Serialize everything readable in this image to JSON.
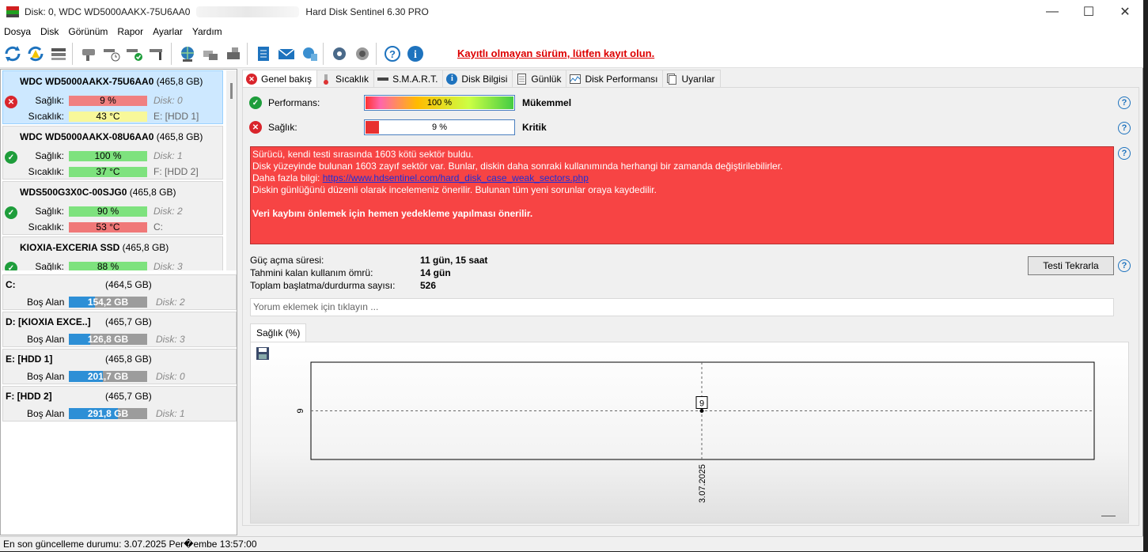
{
  "window": {
    "title_disk": "Disk: 0, WDC WD5000AAKX-75U6AA0",
    "title_app": "Hard Disk Sentinel 6.30 PRO",
    "min": "—",
    "max": "☐",
    "close": "✕"
  },
  "menu": [
    "Dosya",
    "Disk",
    "Görünüm",
    "Rapor",
    "Ayarlar",
    "Yardım"
  ],
  "toolbar": {
    "register_text": "Kayıtlı olmayan sürüm, lütfen kayıt olun."
  },
  "disks": [
    {
      "name": "WDC WD5000AAKX-75U6AA0",
      "size": "(465,8 GB)",
      "status": "bad",
      "health_label": "Sağlık:",
      "health": "9 %",
      "health_value": 9,
      "temp_label": "Sıcaklık:",
      "temp": "43 °C",
      "disk_ref": "Disk: 0",
      "drive": "E: [HDD 1]",
      "selected": true
    },
    {
      "name": "WDC WD5000AAKX-08U6AA0",
      "size": "(465,8 GB)",
      "status": "ok",
      "health_label": "Sağlık:",
      "health": "100 %",
      "health_value": 100,
      "temp_label": "Sıcaklık:",
      "temp": "37 °C",
      "disk_ref": "Disk: 1",
      "drive": "F: [HDD 2]"
    },
    {
      "name": "WDS500G3X0C-00SJG0",
      "size": "(465,8 GB)",
      "status": "ok",
      "health_label": "Sağlık:",
      "health": "90 %",
      "health_value": 90,
      "temp_label": "Sıcaklık:",
      "temp": "53 °C",
      "disk_ref": "Disk: 2",
      "drive": "C:"
    },
    {
      "name": "KIOXIA-EXCERIA SSD",
      "size": "(465,8 GB)",
      "status": "ok",
      "health_label": "Sağlık:",
      "health": "88 %",
      "health_value": 88,
      "disk_ref": "Disk: 3"
    }
  ],
  "volumes": [
    {
      "name": "C:",
      "size": "(464,5 GB)",
      "free_label": "Boş Alan",
      "free": "154,2 GB",
      "free_fraction": 0.33,
      "disk": "Disk: 2"
    },
    {
      "name": "D: [KIOXIA EXCE..]",
      "size": "(465,7 GB)",
      "free_label": "Boş Alan",
      "free": "126,8 GB",
      "free_fraction": 0.27,
      "disk": "Disk: 3"
    },
    {
      "name": "E: [HDD 1]",
      "size": "(465,8 GB)",
      "free_label": "Boş Alan",
      "free": "201,7 GB",
      "free_fraction": 0.43,
      "disk": "Disk: 0"
    },
    {
      "name": "F: [HDD 2]",
      "size": "(465,7 GB)",
      "free_label": "Boş Alan",
      "free": "291,8 GB",
      "free_fraction": 0.63,
      "disk": "Disk: 1"
    }
  ],
  "tabs": [
    "Genel bakış",
    "Sıcaklık",
    "S.M.A.R.T.",
    "Disk Bilgisi",
    "Günlük",
    "Disk Performansı",
    "Uyarılar"
  ],
  "overview": {
    "performance_label": "Performans:",
    "performance": "100 %",
    "performance_value": 100,
    "performance_word": "Mükemmel",
    "health_label": "Sağlık:",
    "health": "9 %",
    "health_value": 9,
    "health_word": "Kritik",
    "alert_lines": [
      "Sürücü, kendi testi sırasında 1603 kötü sektör buldu.",
      "Disk yüzeyinde bulunan 1603 zayıf sektör var. Bunlar, diskin daha sonraki kullanımında herhangi bir zamanda değiştirilebilirler."
    ],
    "alert_more_prefix": "Daha fazla bilgi: ",
    "alert_link": "https://www.hdsentinel.com/hard_disk_case_weak_sectors.php",
    "alert_line4": "Diskin günlüğünü düzenli olarak incelemeniz önerilir. Bulunan tüm yeni sorunlar oraya kaydedilir.",
    "alert_strong": "Veri kaybını önlemek için hemen yedekleme yapılması önerilir.",
    "power_on_label": "Güç açma süresi:",
    "power_on": "11 gün, 15 saat",
    "remaining_label": "Tahmini kalan kullanım ömrü:",
    "remaining": "14 gün",
    "startstop_label": "Toplam başlatma/durdurma sayısı:",
    "startstop": "526",
    "retest": "Testi Tekrarla",
    "comment_placeholder": "Yorum eklemek için tıklayın ...",
    "subtab": "Sağlık (%)"
  },
  "chart_data": {
    "type": "line",
    "x": [
      "3.07.2025"
    ],
    "series": [
      {
        "values": [
          9
        ]
      }
    ],
    "data_labels": [
      "9"
    ],
    "ytick_labels": [
      "9"
    ],
    "xtick_labels": [
      "3.07.2025"
    ]
  },
  "statusbar": "En son güncelleme durumu: 3.07.2025 Per�embe 13:57:00",
  "colors": {
    "alert_bg": "#f74444",
    "health_bad": "#d9252c",
    "health_ok": "#1e9d3b",
    "accent": "#2d8fd6"
  }
}
